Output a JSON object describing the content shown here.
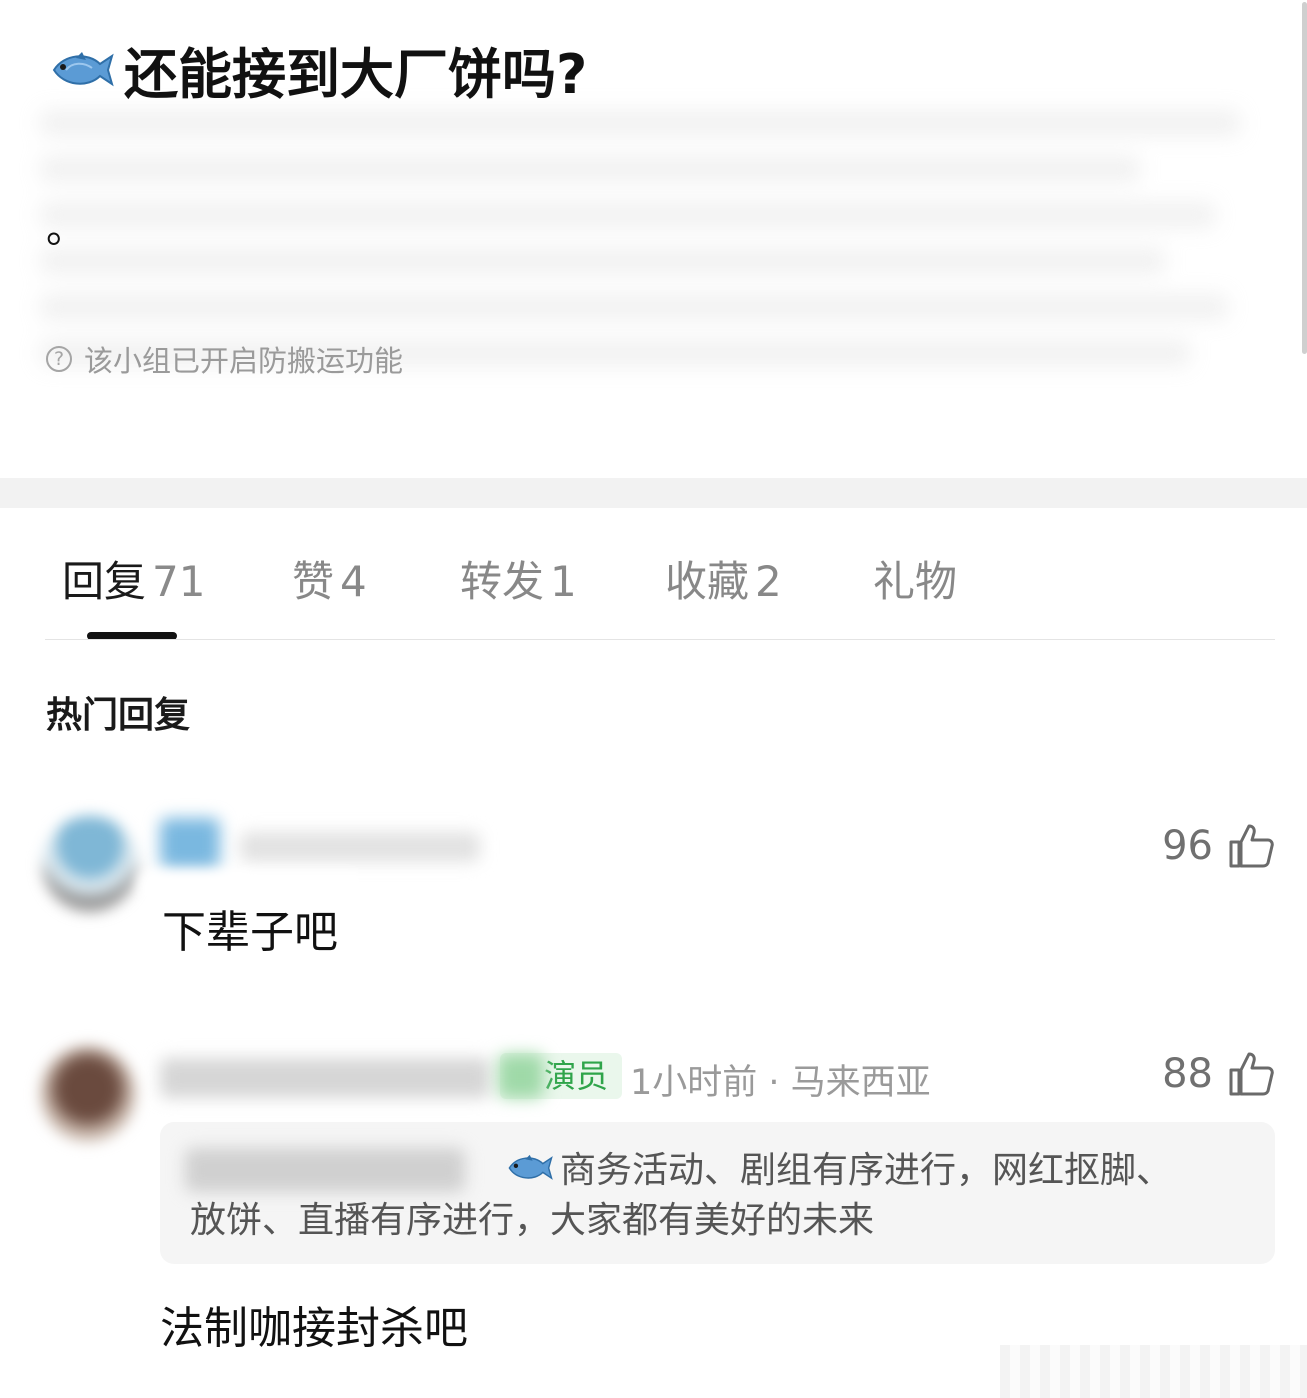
{
  "post": {
    "title_icon": "fish-icon",
    "title": "还能接到大厂饼吗?",
    "body_text": "。",
    "notice": "该小组已开启防搬运功能"
  },
  "tabs": [
    {
      "label": "回复",
      "count": "71",
      "active": true
    },
    {
      "label": "赞",
      "count": "4",
      "active": false
    },
    {
      "label": "转发",
      "count": "1",
      "active": false
    },
    {
      "label": "收藏",
      "count": "2",
      "active": false
    },
    {
      "label": "礼物",
      "count": "",
      "active": false
    }
  ],
  "section_title": "热门回复",
  "comments": [
    {
      "likes": "96",
      "text": "下辈子吧"
    },
    {
      "badge": "演员",
      "meta": "1小时前 · 马来西亚",
      "likes": "88",
      "quote": {
        "icon": "fish-icon",
        "line1": "商务活动、剧组有序进行，网红抠脚、",
        "line2": "放饼、直播有序进行，大家都有美好的未来"
      },
      "text": "法制咖接封杀吧"
    }
  ],
  "colors": {
    "accent": "#111111",
    "muted": "#9a9a9a",
    "member_green": "#2fa44a"
  }
}
